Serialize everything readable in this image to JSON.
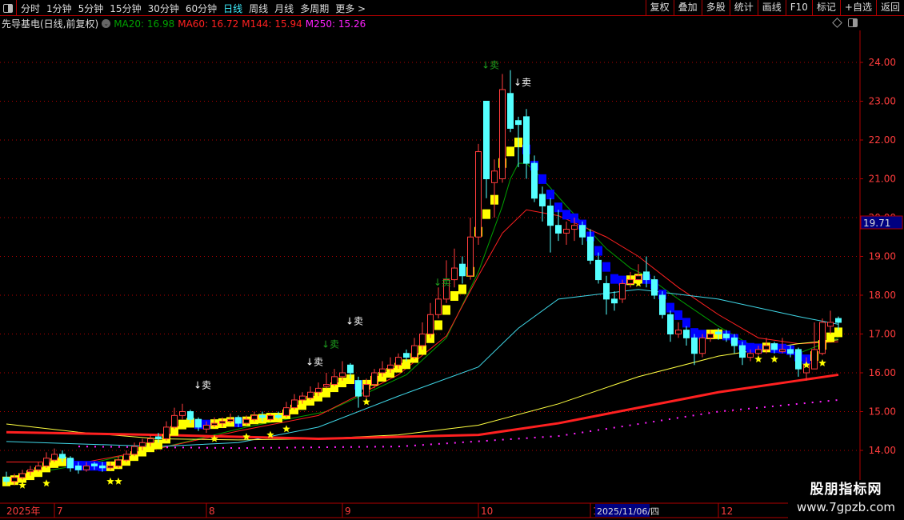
{
  "toolbar": {
    "periods": [
      "分时",
      "1分钟",
      "5分钟",
      "15分钟",
      "30分钟",
      "60分钟",
      "日线",
      "周线",
      "月线",
      "多周期",
      "更多 >"
    ],
    "active_period": "日线",
    "tools": [
      "复权",
      "叠加",
      "多股",
      "统计",
      "画线",
      "F10",
      "标记",
      "+自选",
      "返回"
    ]
  },
  "title": {
    "stock": "先导基电(日线,前复权)",
    "ma20": "MA20: 16.98",
    "ma60": "MA60: 16.72",
    "m144": "M144: 15.94",
    "m250": "M250: 15.26"
  },
  "colors": {
    "ma20": "#00a000",
    "ma60": "#ff2020",
    "m144": "#ff2020",
    "m250": "#ff20ff",
    "up": "#ff3c3c",
    "down": "#54ffff",
    "grid": "#b00000",
    "axis_text": "#ff3c3c"
  },
  "watermark": {
    "name": "股朋指标网",
    "url": "www.7gpzb.com"
  },
  "crosshair": {
    "price_label": "19.71",
    "date_label": "2025/11/06/四"
  },
  "chart_data": {
    "type": "candlestick",
    "ylim": [
      13.0,
      24.4
    ],
    "yticks": [
      "24.00",
      "23.00",
      "22.00",
      "21.00",
      "20.00",
      "19.00",
      "18.00",
      "17.00",
      "16.00",
      "15.00",
      "14.00"
    ],
    "ytick_values": [
      24,
      23,
      22,
      21,
      20,
      19,
      18,
      17,
      16,
      15,
      14
    ],
    "xlabels": [
      {
        "i": 0,
        "label": "2025年"
      },
      {
        "i": 6,
        "label": "7"
      },
      {
        "i": 25,
        "label": "8"
      },
      {
        "i": 42,
        "label": "9"
      },
      {
        "i": 59,
        "label": "10"
      },
      {
        "i": 73,
        "label": "11"
      },
      {
        "i": 89,
        "label": "12"
      }
    ],
    "crosshair_index": 75,
    "candles_ohlc": [
      [
        13.3,
        13.45,
        13.1,
        13.2
      ],
      [
        13.2,
        13.4,
        13.1,
        13.3
      ],
      [
        13.3,
        13.5,
        13.25,
        13.4
      ],
      [
        13.45,
        13.6,
        13.35,
        13.5
      ],
      [
        13.5,
        13.7,
        13.45,
        13.6
      ],
      [
        13.6,
        13.95,
        13.55,
        13.8
      ],
      [
        13.75,
        14.05,
        13.7,
        13.9
      ],
      [
        13.9,
        14.0,
        13.7,
        13.8
      ],
      [
        13.8,
        13.85,
        13.45,
        13.55
      ],
      [
        13.6,
        13.7,
        13.4,
        13.5
      ],
      [
        13.5,
        13.7,
        13.45,
        13.6
      ],
      [
        13.65,
        13.7,
        13.5,
        13.6
      ],
      [
        13.6,
        13.7,
        13.45,
        13.55
      ],
      [
        13.55,
        13.7,
        13.5,
        13.6
      ],
      [
        13.6,
        13.85,
        13.55,
        13.75
      ],
      [
        13.75,
        14.0,
        13.7,
        13.9
      ],
      [
        13.9,
        14.2,
        13.85,
        14.1
      ],
      [
        14.1,
        14.3,
        14.0,
        14.2
      ],
      [
        14.2,
        14.4,
        14.1,
        14.3
      ],
      [
        14.35,
        14.45,
        14.2,
        14.3
      ],
      [
        14.3,
        14.75,
        14.25,
        14.6
      ],
      [
        14.6,
        15.1,
        14.55,
        14.9
      ],
      [
        14.9,
        15.2,
        14.8,
        15.0
      ],
      [
        15.0,
        15.05,
        14.7,
        14.8
      ],
      [
        14.8,
        14.85,
        14.5,
        14.6
      ],
      [
        14.55,
        14.75,
        14.45,
        14.65
      ],
      [
        14.65,
        14.85,
        14.6,
        14.7
      ],
      [
        14.7,
        14.85,
        14.6,
        14.75
      ],
      [
        14.75,
        14.95,
        14.7,
        14.8
      ],
      [
        14.85,
        14.9,
        14.6,
        14.7
      ],
      [
        14.7,
        14.9,
        14.65,
        14.8
      ],
      [
        14.8,
        15.0,
        14.75,
        14.9
      ],
      [
        14.9,
        15.0,
        14.75,
        14.85
      ],
      [
        14.8,
        14.95,
        14.75,
        14.9
      ],
      [
        14.9,
        15.0,
        14.8,
        14.85
      ],
      [
        14.9,
        15.25,
        14.85,
        15.1
      ],
      [
        15.1,
        15.45,
        15.05,
        15.3
      ],
      [
        15.3,
        15.5,
        15.2,
        15.4
      ],
      [
        15.35,
        15.65,
        15.3,
        15.5
      ],
      [
        15.5,
        15.75,
        15.4,
        15.6
      ],
      [
        15.65,
        16.0,
        15.6,
        15.7
      ],
      [
        15.7,
        16.1,
        15.65,
        15.9
      ],
      [
        15.9,
        16.3,
        15.8,
        16.0
      ],
      [
        16.2,
        16.25,
        15.85,
        16.0
      ],
      [
        15.8,
        15.9,
        15.1,
        15.4
      ],
      [
        15.4,
        15.85,
        15.35,
        15.7
      ],
      [
        15.7,
        16.1,
        15.6,
        16.0
      ],
      [
        16.0,
        16.3,
        15.9,
        16.1
      ],
      [
        16.1,
        16.4,
        16.0,
        16.2
      ],
      [
        16.2,
        16.5,
        16.1,
        16.4
      ],
      [
        16.5,
        16.6,
        16.3,
        16.4
      ],
      [
        16.4,
        16.9,
        16.35,
        16.7
      ],
      [
        16.7,
        17.3,
        16.6,
        17.0
      ],
      [
        17.0,
        17.8,
        16.9,
        17.5
      ],
      [
        17.5,
        18.2,
        17.4,
        17.9
      ],
      [
        17.9,
        18.9,
        17.8,
        18.4
      ],
      [
        18.4,
        19.2,
        18.2,
        18.7
      ],
      [
        18.8,
        19.0,
        18.3,
        18.5
      ],
      [
        18.5,
        20.0,
        18.4,
        19.5
      ],
      [
        19.5,
        21.9,
        19.3,
        21.7
      ],
      [
        23.0,
        23.0,
        20.5,
        21.0
      ],
      [
        20.9,
        21.5,
        20.0,
        21.2
      ],
      [
        21.0,
        23.7,
        20.9,
        23.3
      ],
      [
        23.2,
        23.8,
        22.2,
        22.3
      ],
      [
        22.5,
        22.6,
        21.3,
        22.4
      ],
      [
        22.6,
        22.8,
        21.0,
        21.4
      ],
      [
        21.4,
        21.6,
        20.4,
        20.5
      ],
      [
        20.6,
        20.8,
        19.9,
        20.3
      ],
      [
        20.3,
        20.5,
        19.1,
        19.8
      ],
      [
        19.8,
        20.2,
        19.4,
        19.6
      ],
      [
        19.6,
        19.9,
        19.3,
        19.7
      ],
      [
        19.7,
        20.0,
        19.4,
        19.8
      ],
      [
        19.8,
        19.9,
        19.3,
        19.5
      ],
      [
        19.5,
        19.7,
        18.8,
        18.9
      ],
      [
        18.9,
        19.1,
        18.3,
        18.4
      ],
      [
        18.3,
        18.5,
        17.5,
        17.9
      ],
      [
        17.9,
        18.1,
        17.6,
        17.8
      ],
      [
        17.9,
        18.4,
        17.8,
        18.3
      ],
      [
        18.3,
        18.6,
        18.2,
        18.4
      ],
      [
        18.4,
        18.8,
        18.3,
        18.5
      ],
      [
        18.6,
        19.0,
        18.2,
        18.4
      ],
      [
        18.4,
        18.5,
        17.9,
        18.0
      ],
      [
        18.0,
        18.1,
        17.4,
        17.5
      ],
      [
        17.5,
        17.6,
        16.8,
        17.0
      ],
      [
        17.0,
        17.3,
        16.9,
        17.1
      ],
      [
        17.1,
        17.2,
        16.7,
        16.9
      ],
      [
        16.9,
        17.0,
        16.2,
        16.5
      ],
      [
        16.5,
        17.0,
        16.4,
        16.9
      ],
      [
        16.9,
        17.1,
        16.8,
        17.0
      ],
      [
        17.05,
        17.15,
        16.85,
        17.0
      ],
      [
        17.0,
        17.1,
        16.8,
        16.9
      ],
      [
        16.9,
        17.0,
        16.5,
        16.7
      ],
      [
        16.7,
        16.8,
        16.2,
        16.4
      ],
      [
        16.4,
        16.6,
        16.3,
        16.5
      ],
      [
        16.5,
        16.7,
        16.45,
        16.6
      ],
      [
        16.6,
        16.9,
        16.5,
        16.7
      ],
      [
        16.75,
        16.8,
        16.5,
        16.6
      ],
      [
        16.55,
        16.9,
        16.5,
        16.6
      ],
      [
        16.6,
        16.7,
        16.4,
        16.5
      ],
      [
        16.6,
        16.65,
        15.9,
        16.1
      ],
      [
        16.0,
        16.4,
        15.8,
        16.2
      ],
      [
        16.1,
        17.3,
        16.1,
        16.6
      ],
      [
        16.5,
        17.4,
        16.45,
        17.3
      ],
      [
        17.2,
        17.6,
        17.0,
        17.3
      ],
      [
        17.4,
        17.45,
        17.1,
        17.3
      ]
    ],
    "lines": [
      {
        "key": "ma20",
        "color": "#00a000",
        "width": 1,
        "dash": "",
        "points": [
          [
            0,
            13.3
          ],
          [
            10,
            13.65
          ],
          [
            20,
            14.1
          ],
          [
            30,
            14.6
          ],
          [
            40,
            15.0
          ],
          [
            50,
            15.95
          ],
          [
            55,
            16.9
          ],
          [
            59,
            18.6
          ],
          [
            62,
            20.3
          ],
          [
            63,
            21.0
          ],
          [
            64,
            21.4
          ],
          [
            65,
            21.4
          ],
          [
            67,
            21.0
          ],
          [
            70,
            20.3
          ],
          [
            75,
            19.2
          ],
          [
            78,
            18.7
          ],
          [
            80,
            18.5
          ],
          [
            84,
            17.9
          ],
          [
            89,
            17.2
          ],
          [
            94,
            16.6
          ],
          [
            99,
            16.5
          ],
          [
            104,
            16.9
          ]
        ]
      },
      {
        "key": "ma60",
        "color": "#ff2020",
        "width": 1,
        "dash": "",
        "points": [
          [
            0,
            13.7
          ],
          [
            10,
            13.7
          ],
          [
            19,
            14.05
          ],
          [
            29,
            14.5
          ],
          [
            39,
            14.9
          ],
          [
            49,
            15.95
          ],
          [
            55,
            16.95
          ],
          [
            59,
            18.5
          ],
          [
            62,
            19.6
          ],
          [
            65,
            20.2
          ],
          [
            69,
            20.05
          ],
          [
            75,
            19.5
          ],
          [
            79,
            19.0
          ],
          [
            84,
            18.2
          ],
          [
            89,
            17.5
          ],
          [
            94,
            16.9
          ],
          [
            99,
            16.75
          ],
          [
            104,
            16.8
          ]
        ]
      },
      {
        "key": "cyan",
        "color": "#3fd8e8",
        "width": 1,
        "dash": "",
        "points": [
          [
            0,
            14.23
          ],
          [
            19,
            14.1
          ],
          [
            29,
            14.2
          ],
          [
            39,
            14.6
          ],
          [
            49,
            15.4
          ],
          [
            59,
            16.15
          ],
          [
            64,
            17.15
          ],
          [
            69,
            17.9
          ],
          [
            79,
            18.15
          ],
          [
            89,
            17.9
          ],
          [
            99,
            17.45
          ],
          [
            104,
            17.25
          ]
        ]
      },
      {
        "key": "yellow",
        "color": "#ffff40",
        "width": 1,
        "dash": "",
        "points": [
          [
            0,
            14.68
          ],
          [
            9,
            14.47
          ],
          [
            19,
            14.3
          ],
          [
            29,
            14.27
          ],
          [
            39,
            14.3
          ],
          [
            49,
            14.4
          ],
          [
            59,
            14.65
          ],
          [
            69,
            15.2
          ],
          [
            79,
            15.9
          ],
          [
            89,
            16.43
          ],
          [
            99,
            16.75
          ],
          [
            104,
            16.85
          ]
        ]
      },
      {
        "key": "m144",
        "color": "#ff2020",
        "width": 3,
        "dash": "",
        "points": [
          [
            0,
            14.47
          ],
          [
            19,
            14.4
          ],
          [
            39,
            14.3
          ],
          [
            59,
            14.4
          ],
          [
            69,
            14.7
          ],
          [
            79,
            15.1
          ],
          [
            89,
            15.5
          ],
          [
            99,
            15.8
          ],
          [
            104,
            15.95
          ]
        ]
      },
      {
        "key": "m250",
        "color": "#ff20ff",
        "width": 2,
        "dash": "2,8",
        "points": [
          [
            9,
            14.1
          ],
          [
            29,
            14.06
          ],
          [
            49,
            14.1
          ],
          [
            69,
            14.37
          ],
          [
            79,
            14.68
          ],
          [
            89,
            15.0
          ],
          [
            99,
            15.2
          ],
          [
            104,
            15.3
          ]
        ]
      }
    ],
    "stars": [
      [
        2,
        13.1
      ],
      [
        5,
        13.15
      ],
      [
        13,
        13.2
      ],
      [
        14,
        13.2
      ],
      [
        26,
        14.3
      ],
      [
        30,
        14.35
      ],
      [
        33,
        14.4
      ],
      [
        35,
        14.55
      ],
      [
        45,
        15.25
      ],
      [
        79,
        18.3
      ],
      [
        94,
        16.35
      ],
      [
        96,
        16.35
      ],
      [
        100,
        16.2
      ],
      [
        102,
        16.25
      ]
    ],
    "signals": [
      {
        "i": 24,
        "price": 15.6,
        "label": "↓卖",
        "color": "#ffffff"
      },
      {
        "i": 38,
        "price": 16.2,
        "label": "↓卖",
        "color": "#ffffff"
      },
      {
        "i": 40,
        "price": 16.65,
        "label": "↓卖",
        "color": "#1ea01e"
      },
      {
        "i": 43,
        "price": 17.25,
        "label": "↓卖",
        "color": "#ffffff"
      },
      {
        "i": 54,
        "price": 18.25,
        "label": "↓卖",
        "color": "#1ea01e"
      },
      {
        "i": 60,
        "price": 23.85,
        "label": "↓卖",
        "color": "#1ea01e"
      },
      {
        "i": 64,
        "price": 23.4,
        "label": "↓卖",
        "color": "#ffffff"
      }
    ]
  }
}
